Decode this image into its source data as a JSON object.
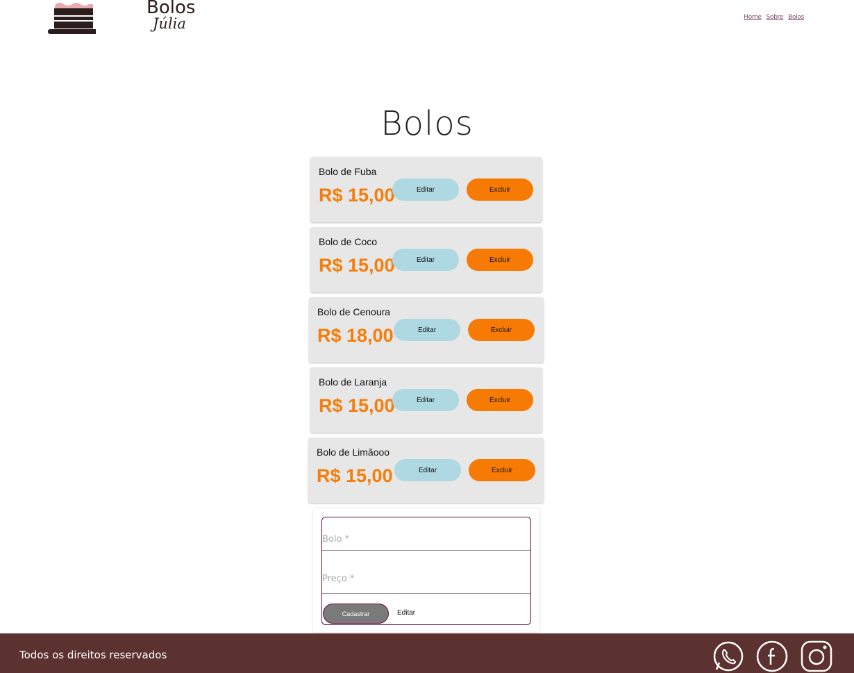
{
  "header": {
    "logo_line1": "Bolos",
    "logo_line2": "Júlia",
    "nav": [
      "Home",
      "Sobre",
      "Bolos"
    ]
  },
  "main": {
    "title": "Bolos",
    "cakes": [
      {
        "name": "Bolo de Fuba",
        "price": "R$ 15,00"
      },
      {
        "name": "Bolo de Coco",
        "price": "R$ 15,00"
      },
      {
        "name": "Bolo de Cenoura",
        "price": "R$ 18,00"
      },
      {
        "name": "Bolo de Laranja",
        "price": "R$ 15,00"
      },
      {
        "name": "Bolo de Limãooo",
        "price": "R$ 15,00"
      }
    ],
    "edit_label": "Editar",
    "delete_label": "Excluir"
  },
  "form": {
    "bolo_placeholder": "Bolo *",
    "preco_placeholder": "Preço *",
    "submit_label": "Cadastrar",
    "edit_label": "Editar"
  },
  "footer": {
    "text": "Todos os direitos reservados",
    "icons": [
      "whatsapp-icon",
      "facebook-icon",
      "instagram-icon"
    ]
  },
  "colors": {
    "price": "#f57d0a",
    "edit_button": "#aed8e2",
    "delete_button": "#f77a04",
    "footer_bg": "#5c3230",
    "card_bg": "#e8e7e7"
  }
}
